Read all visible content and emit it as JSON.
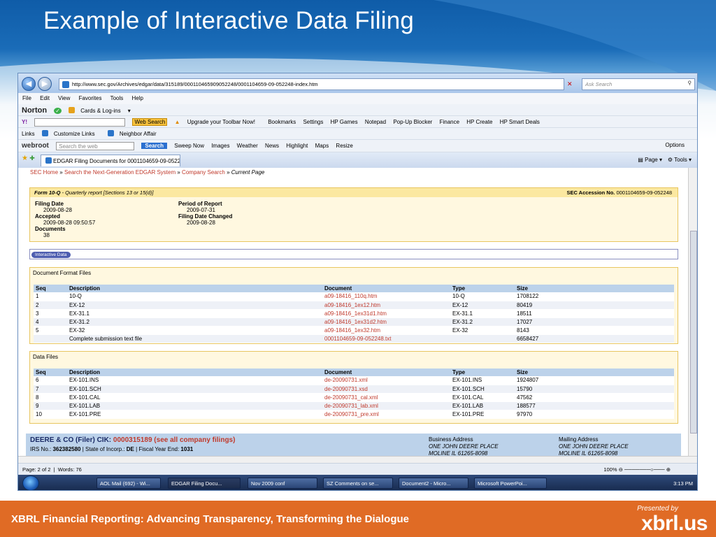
{
  "slide": {
    "title": "Example of Interactive Data Filing",
    "footer": "XBRL Financial Reporting: Advancing Transparency, Transforming the Dialogue",
    "presented_by": "Presented by",
    "logo": "xbrl.us"
  },
  "browser": {
    "url": "http://www.sec.gov/Archives/edgar/data/315189/000110465909052248/0001104659-09-052248-index.htm",
    "search_placeholder": "Ask Search",
    "menu": [
      "File",
      "Edit",
      "View",
      "Favorites",
      "Tools",
      "Help"
    ],
    "norton": {
      "brand": "Norton",
      "cards": "Cards & Log-ins"
    },
    "yahoo_toolbar": {
      "web_search": "Web Search",
      "upgrade": "Upgrade your Toolbar Now!",
      "bookmarks": "Bookmarks",
      "settings": "Settings",
      "hp_games": "HP Games",
      "notepad": "Notepad",
      "popup_blocker": "Pop-Up Blocker",
      "finance": "Finance",
      "hp_create": "HP Create",
      "hp_smart_deals": "HP Smart Deals"
    },
    "links": {
      "label": "Links",
      "customize": "Customize Links",
      "neighbor": "Neighbor Affair"
    },
    "webroot": {
      "brand": "webroot",
      "search_placeholder": "Search the web",
      "search_btn": "Search",
      "sweep_now": "Sweep Now",
      "images": "Images",
      "weather": "Weather",
      "news": "News",
      "highlight": "Highlight",
      "maps": "Maps",
      "resize": "Resize",
      "options": "Options"
    },
    "tab_title": "EDGAR Filing Documents for 0001104659-09-0522...",
    "cmd": {
      "page": "Page",
      "tools": "Tools"
    }
  },
  "page": {
    "breadcrumb": [
      "SEC Home",
      "Search the Next-Generation EDGAR System",
      "Company Search"
    ],
    "breadcrumb_sep": "»",
    "breadcrumb_current": "Current Page",
    "form_title": "Form 10-Q",
    "form_desc": " - Quarterly report [Sections 13 or 15(d)]",
    "accession_label": "SEC Accession No.",
    "accession_value": "0001104659-09-052248",
    "filing_date_label": "Filing Date",
    "filing_date": "2009-08-28",
    "accepted_label": "Accepted",
    "accepted": "2009-08-28 09:50:57",
    "documents_label": "Documents",
    "documents": "38",
    "period_label": "Period of Report",
    "period": "2009-07-31",
    "changed_label": "Filing Date Changed",
    "changed": "2009-08-28",
    "interactive_btn": "Interactive Data",
    "columns": [
      "Seq",
      "Description",
      "Document",
      "Type",
      "Size"
    ],
    "doc_format_title": "Document Format Files",
    "doc_format_rows": [
      [
        "1",
        "10-Q",
        "a09-18416_110q.htm",
        "10-Q",
        "1708122"
      ],
      [
        "2",
        "EX-12",
        "a09-18416_1ex12.htm",
        "EX-12",
        "80419"
      ],
      [
        "3",
        "EX-31.1",
        "a09-18416_1ex31d1.htm",
        "EX-31.1",
        "18511"
      ],
      [
        "4",
        "EX-31.2",
        "a09-18416_1ex31d2.htm",
        "EX-31.2",
        "17027"
      ],
      [
        "5",
        "EX-32",
        "a09-18416_1ex32.htm",
        "EX-32",
        "8143"
      ],
      [
        "",
        "Complete submission text file",
        "0001104659-09-052248.txt",
        "",
        "6658427"
      ]
    ],
    "data_files_title": "Data Files",
    "data_files_rows": [
      [
        "6",
        "EX-101.INS",
        "de-20090731.xml",
        "EX-101.INS",
        "1924807"
      ],
      [
        "7",
        "EX-101.SCH",
        "de-20090731.xsd",
        "EX-101.SCH",
        "15790"
      ],
      [
        "8",
        "EX-101.CAL",
        "de-20090731_cal.xml",
        "EX-101.CAL",
        "47562"
      ],
      [
        "9",
        "EX-101.LAB",
        "de-20090731_lab.xml",
        "EX-101.LAB",
        "188577"
      ],
      [
        "10",
        "EX-101.PRE",
        "de-20090731_pre.xml",
        "EX-101.PRE",
        "97970"
      ]
    ],
    "company_name": "DEERE & CO (Filer) CIK: ",
    "company_cik": "0000315189 (see all company filings)",
    "irs_label": "IRS No.: ",
    "irs_no": "362382580",
    "state_label": " | State of Incorp.: ",
    "state": "DE",
    "fy_label": " | Fiscal Year End: ",
    "fy": "1031",
    "business_label": "Business Address",
    "business_1": "ONE JOHN DEERE PLACE",
    "business_2": "MOLINE IL 61265-8098",
    "mailing_label": "Mailing Address",
    "mailing_1": "ONE JOHN DEERE PLACE",
    "mailing_2": "MOLINE IL 61265-8098"
  },
  "status": {
    "page": "Page: 2 of 2",
    "words": "Words: 76",
    "zoom": "100%"
  },
  "taskbar": {
    "items": [
      "AOL Mail (692) - Wi...",
      "EDGAR Filing Docu...",
      "Nov 2009 conf",
      "SZ Comments on se...",
      "Document2 - Micro...",
      "Microsoft PowerPoi..."
    ],
    "clock": "3:13 PM"
  }
}
